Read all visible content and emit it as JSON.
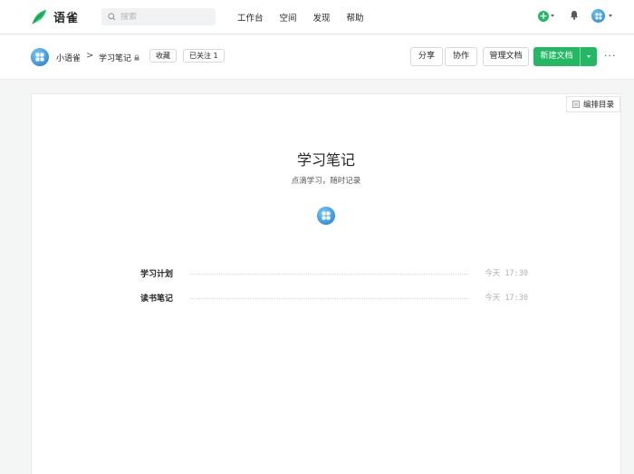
{
  "brand": {
    "name": "语雀",
    "logo_icon": "yuque-bird-icon",
    "color": "#25b864"
  },
  "search": {
    "placeholder": "搜索"
  },
  "nav": {
    "links": [
      "工作台",
      "空间",
      "发现",
      "帮助"
    ]
  },
  "header_actions": {
    "add_icon": "plus-circle-icon",
    "bell_icon": "bell-icon",
    "avatar_icon": "windows-avatar-icon"
  },
  "breadcrumb": {
    "space": "小语雀",
    "separator": ">",
    "book": "学习笔记",
    "lock_icon": "lock-icon"
  },
  "book_actions": {
    "favorite": "收藏",
    "follow": "已关注 1"
  },
  "toolbar": {
    "share": "分享",
    "collaborate": "协作",
    "manage": "管理文档",
    "new_doc": "新建文档",
    "more": "···"
  },
  "book": {
    "toc_button": "编排目录",
    "title": "学习笔记",
    "description": "点滴学习，随时记录",
    "docs": [
      {
        "title": "学习计划",
        "time": "今天 17:30"
      },
      {
        "title": "读书笔记",
        "time": "今天 17:30"
      }
    ]
  }
}
